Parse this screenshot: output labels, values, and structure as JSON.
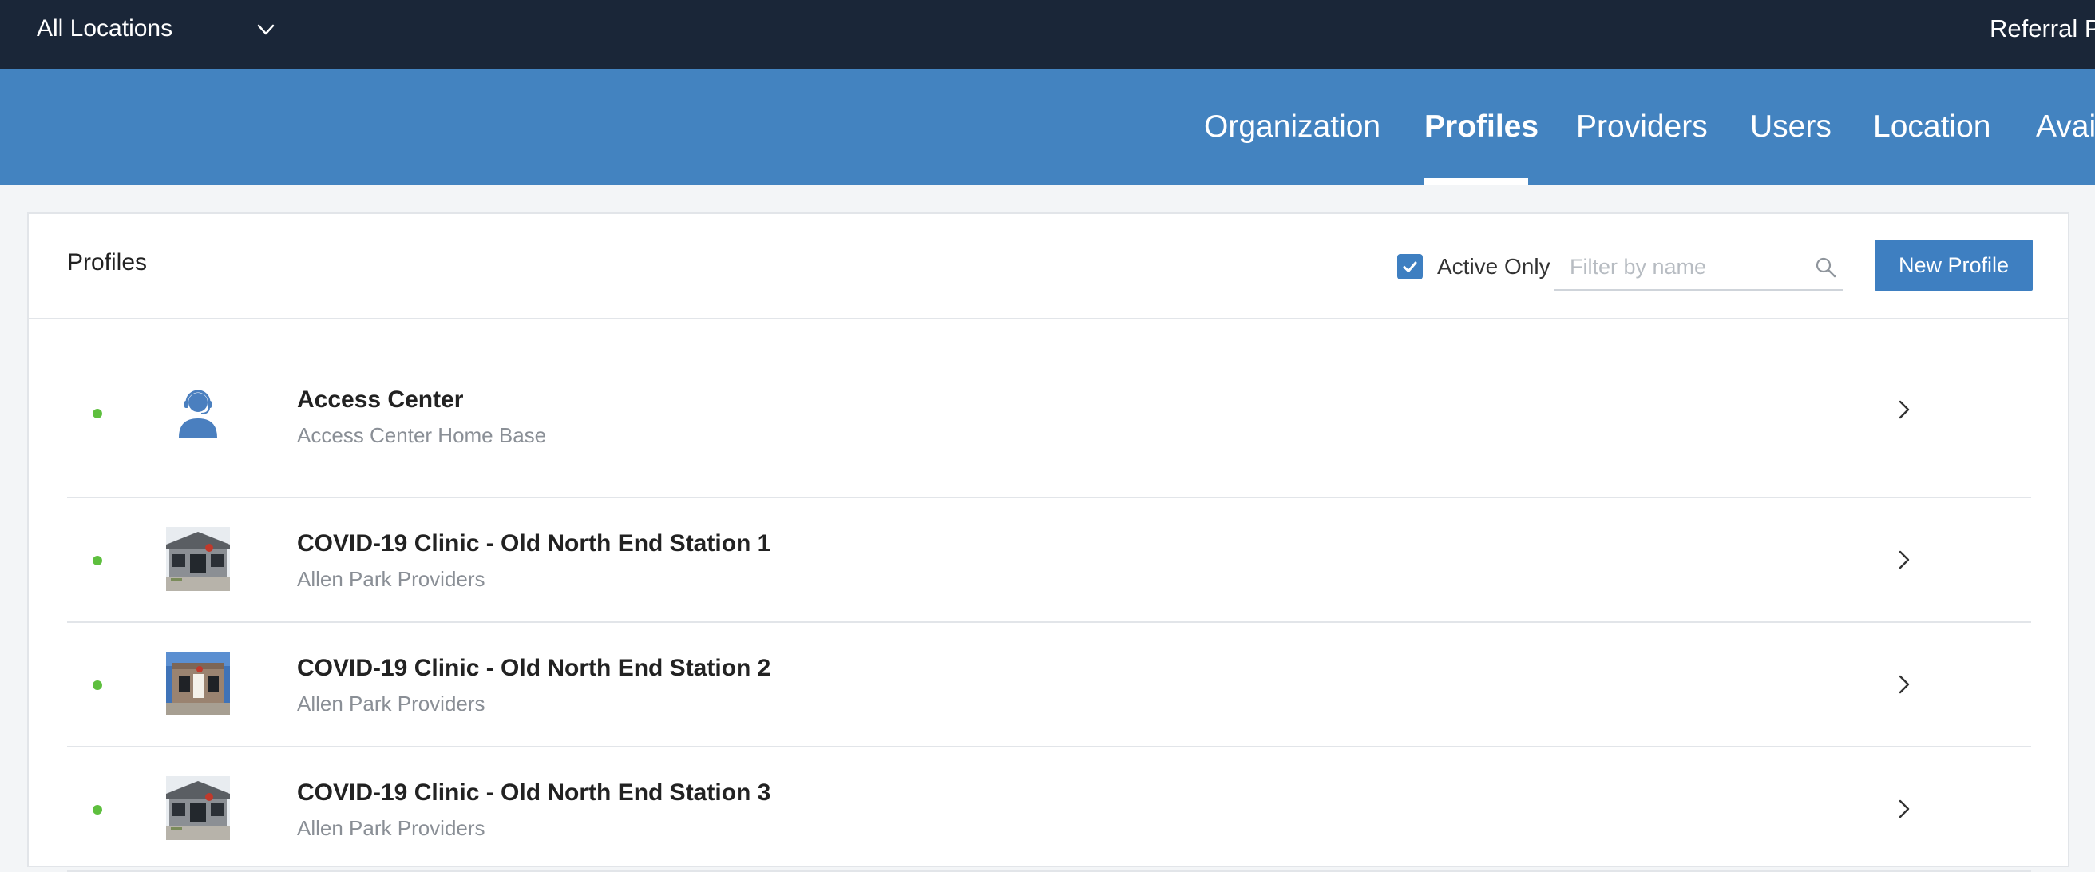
{
  "topbar": {
    "location_selector": {
      "value": "All Locations",
      "icon": "chevron-down-icon"
    },
    "right_link": "Referral Po"
  },
  "nav": {
    "tabs": [
      {
        "label": "Organization",
        "active": false
      },
      {
        "label": "Profiles",
        "active": true
      },
      {
        "label": "Providers",
        "active": false
      },
      {
        "label": "Users",
        "active": false
      },
      {
        "label": "Location",
        "active": false
      },
      {
        "label": "Avail",
        "active": false
      }
    ]
  },
  "profiles_panel": {
    "title": "Profiles",
    "active_only": {
      "label": "Active Only",
      "checked": true
    },
    "filter": {
      "value": "",
      "placeholder": "Filter by name",
      "icon": "search-icon"
    },
    "new_button": "New Profile",
    "items": [
      {
        "title": "Access Center",
        "subtitle": "Access Center Home Base",
        "status": "active",
        "thumbnail": "headset-agent-icon"
      },
      {
        "title": "COVID-19 Clinic - Old North End Station 1",
        "subtitle": "Allen Park Providers",
        "status": "active",
        "thumbnail": "clinic-building-photo"
      },
      {
        "title": "COVID-19 Clinic - Old North End Station 2",
        "subtitle": "Allen Park Providers",
        "status": "active",
        "thumbnail": "clinic-building-photo"
      },
      {
        "title": "COVID-19 Clinic - Old North End Station 3",
        "subtitle": "Allen Park Providers",
        "status": "active",
        "thumbnail": "clinic-building-photo"
      }
    ]
  },
  "colors": {
    "topbar_bg": "#1a2638",
    "nav_bg": "#4383c0",
    "accent": "#3e7fc1",
    "status_active": "#5ebf3e"
  }
}
